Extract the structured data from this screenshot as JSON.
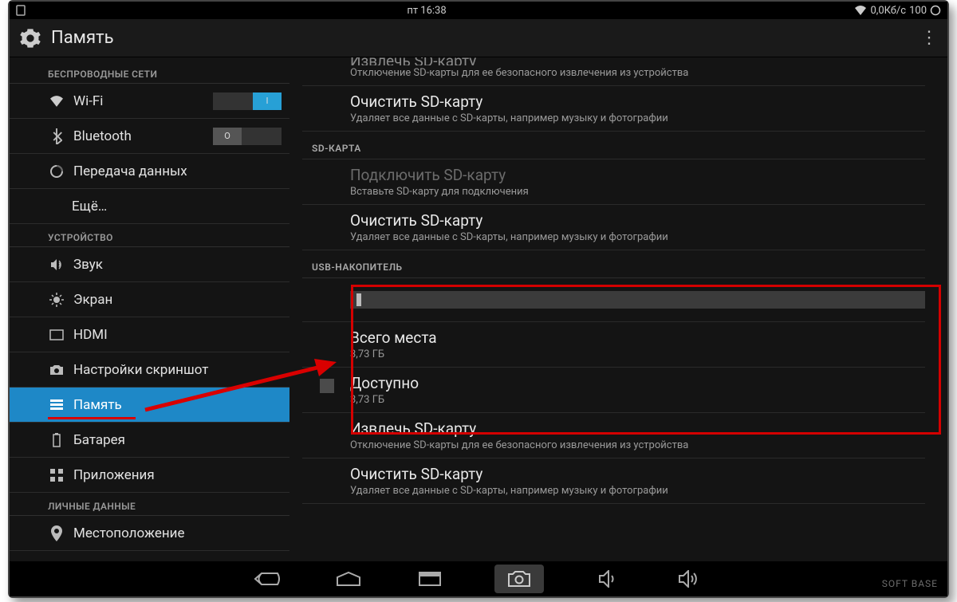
{
  "status": {
    "time": "пт 16:38",
    "net_speed": "0,0Кб/с",
    "battery": "100"
  },
  "header": {
    "title": "Память"
  },
  "sidebar": {
    "cat_wireless": "БЕСПРОВОДНЫЕ СЕТИ",
    "wifi": "Wi-Fi",
    "wifi_state": "I",
    "bluetooth": "Bluetooth",
    "bt_state": "O",
    "data": "Передача данных",
    "more": "Ещё…",
    "cat_device": "УСТРОЙСТВО",
    "sound": "Звук",
    "display": "Экран",
    "hdmi": "HDMI",
    "screenshot": "Настройки скриншот",
    "storage": "Память",
    "battery": "Батарея",
    "apps": "Приложения",
    "cat_personal": "ЛИЧНЫЕ ДАННЫЕ",
    "location": "Местоположение"
  },
  "content": {
    "eject_sd_t": "Извлечь SD-карту",
    "eject_sd_s": "Отключение SD-карты для ее безопасного извлечения из устройства",
    "erase_sd_t": "Очистить SD-карту",
    "erase_sd_s": "Удаляет все данные с SD-карты, например музыку и фотографии",
    "sec_sdcard": "SD-КАРТА",
    "mount_sd_t": "Подключить SD-карту",
    "mount_sd_s": "Вставьте SD-карту для подключения",
    "sec_usb": "USB-НАКОПИТЕЛЬ",
    "total_t": "Всего места",
    "total_s": "3,73 ГБ",
    "avail_t": "Доступно",
    "avail_s": "3,73 ГБ"
  },
  "watermark": "SOFT    BASE"
}
